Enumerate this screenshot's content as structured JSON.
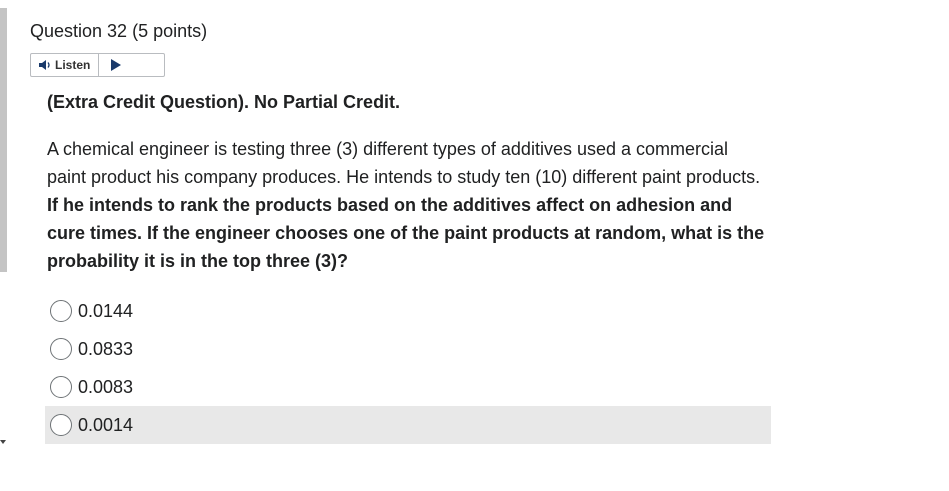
{
  "question": {
    "title": "Question 32",
    "points": "(5 points)"
  },
  "listen": {
    "label": "Listen",
    "speaker_icon": "speaker-icon",
    "play_icon": "play-icon"
  },
  "extra_credit": "(Extra Credit Question). No Partial Credit.",
  "prompt": {
    "plain": "A chemical engineer is testing three (3) different types of additives used a commercial paint product his company produces. He intends to study ten (10) different paint products. ",
    "bold": "If he intends to rank the products based on the additives affect on adhesion and cure times. If the engineer chooses one of the paint products at random, what is the probability it is in the top three (3)?"
  },
  "options": [
    {
      "label": "0.0144"
    },
    {
      "label": "0.0833"
    },
    {
      "label": "0.0083"
    },
    {
      "label": "0.0014"
    }
  ],
  "colors": {
    "highlight_row": "#e8e8e8",
    "play_icon": "#1a3a6b",
    "scroll_thumb": "#c4c4c4"
  }
}
